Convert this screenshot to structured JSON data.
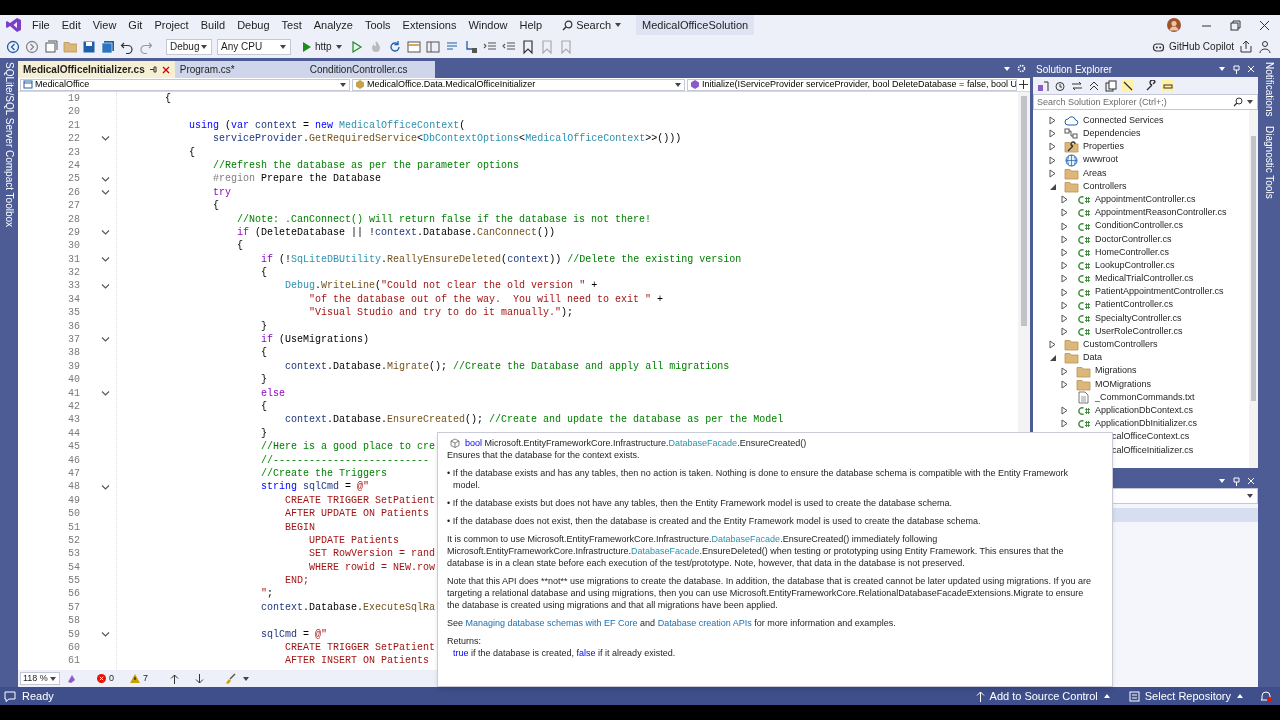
{
  "window": {
    "title": "MedicalOfficeSolution",
    "search_label": "Search"
  },
  "menu": [
    "File",
    "Edit",
    "View",
    "Git",
    "Project",
    "Build",
    "Debug",
    "Test",
    "Analyze",
    "Tools",
    "Extensions",
    "Window",
    "Help"
  ],
  "toolbar": {
    "configuration": "Debug",
    "platform": "Any CPU",
    "run_target": "http",
    "copilot": "GitHub Copilot"
  },
  "side_panels": {
    "left": "SQLite/SQL Server Compact Toolbox",
    "right": [
      "Notifications",
      "Diagnostic Tools"
    ]
  },
  "editor": {
    "tabs": [
      {
        "label": "MedicalOfficeInitializer.cs",
        "selected": true
      },
      {
        "label": "Program.cs*",
        "selected": false
      },
      {
        "label": "ConditionController.cs",
        "selected": false
      }
    ],
    "navigation": [
      "MedicalOffice",
      "MedicalOffice.Data.MedicalOfficeInitializer",
      "Initialize(IServiceProvider serviceProvider, bool DeleteDatabase = false, bool U"
    ],
    "lines": [
      {
        "number": "19",
        "code": [
          "        {"
        ]
      },
      {
        "number": "20"
      },
      {
        "number": "21",
        "code": [
          {
            "text": "            using",
            "kind": "kw"
          },
          " (",
          {
            "text": "var",
            "kind": "kw"
          },
          {
            "text": " context",
            "kind": "var"
          },
          " = ",
          {
            "text": "new",
            "kind": "kw"
          },
          {
            "text": " MedicalOfficeContext",
            "kind": "type"
          },
          "("
        ]
      },
      {
        "number": "22",
        "fold": true,
        "code": [
          {
            "text": "                serviceProvider",
            "kind": "var"
          },
          ".",
          {
            "text": "GetRequiredService",
            "kind": "method"
          },
          "<",
          {
            "text": "DbContextOptions",
            "kind": "type"
          },
          "<",
          {
            "text": "MedicalOfficeContext",
            "kind": "type"
          },
          ">>()))"
        ]
      },
      {
        "number": "23",
        "code": [
          "            {"
        ]
      },
      {
        "number": "24",
        "code": [
          {
            "text": "                //Refresh the database as per the parameter options",
            "kind": "comment"
          }
        ]
      },
      {
        "number": "25",
        "fold": true,
        "code": [
          {
            "text": "                #region",
            "kind": "preproc"
          },
          " Prepare the Database"
        ]
      },
      {
        "number": "26",
        "fold": true,
        "code": [
          {
            "text": "                try",
            "kind": "ctl"
          }
        ]
      },
      {
        "number": "27",
        "code": [
          "                {"
        ]
      },
      {
        "number": "28",
        "code": [
          {
            "text": "                    //Note: .CanConnect() will return false if the database is not there!",
            "kind": "comment"
          }
        ]
      },
      {
        "number": "29",
        "fold": true,
        "code": [
          {
            "text": "                    if",
            "kind": "ctl"
          },
          " (DeleteDatabase || !",
          {
            "text": "context",
            "kind": "var"
          },
          ".Database.",
          {
            "text": "CanConnect",
            "kind": "method"
          },
          "())"
        ]
      },
      {
        "number": "30",
        "code": [
          "                    {"
        ]
      },
      {
        "number": "31",
        "fold": true,
        "code": [
          {
            "text": "                        if",
            "kind": "ctl"
          },
          " (!",
          {
            "text": "SqLiteDBUtility",
            "kind": "type"
          },
          ".",
          {
            "text": "ReallyEnsureDeleted",
            "kind": "method"
          },
          "(",
          {
            "text": "context",
            "kind": "var"
          },
          ")) ",
          {
            "text": "//Delete the existing version",
            "kind": "comment"
          }
        ]
      },
      {
        "number": "32",
        "code": [
          "                        {"
        ]
      },
      {
        "number": "33",
        "fold": true,
        "code": [
          {
            "text": "                            Debug",
            "kind": "type"
          },
          ".",
          {
            "text": "WriteLine",
            "kind": "method"
          },
          "(",
          {
            "text": "\"Could not clear the old version \"",
            "kind": "string"
          },
          " +"
        ]
      },
      {
        "number": "34",
        "code": [
          {
            "text": "                                \"of the database out of the way.  You will need to exit \"",
            "kind": "string"
          },
          " +"
        ]
      },
      {
        "number": "35",
        "code": [
          {
            "text": "                                \"Visual Studio and try to do it manually.\"",
            "kind": "string"
          },
          ");"
        ]
      },
      {
        "number": "36",
        "code": [
          "                        }"
        ]
      },
      {
        "number": "37",
        "fold": true,
        "code": [
          {
            "text": "                        if",
            "kind": "ctl"
          },
          " (UseMigrations)"
        ]
      },
      {
        "number": "38",
        "code": [
          "                        {"
        ]
      },
      {
        "number": "39",
        "code": [
          {
            "text": "                            context",
            "kind": "var"
          },
          ".Database.",
          {
            "text": "Migrate",
            "kind": "method"
          },
          "(); ",
          {
            "text": "//Create the Database and apply all migrations",
            "kind": "comment"
          }
        ]
      },
      {
        "number": "40",
        "code": [
          "                        }"
        ]
      },
      {
        "number": "41",
        "fold": true,
        "code": [
          {
            "text": "                        else",
            "kind": "ctl"
          }
        ]
      },
      {
        "number": "42",
        "code": [
          "                        {"
        ]
      },
      {
        "number": "43",
        "code": [
          {
            "text": "                            context",
            "kind": "var"
          },
          ".Database.",
          {
            "text": "EnsureCreated",
            "kind": "method"
          },
          "(); ",
          {
            "text": "//Create and update the database as per the Model",
            "kind": "comment"
          }
        ]
      },
      {
        "number": "44",
        "code": [
          "                        }"
        ]
      },
      {
        "number": "45",
        "code": [
          {
            "text": "                        //Here is a good place to cre",
            "kind": "comment"
          }
        ]
      },
      {
        "number": "46",
        "code": [
          {
            "text": "                        //--------------------------",
            "kind": "comment"
          }
        ]
      },
      {
        "number": "47",
        "code": [
          {
            "text": "                        //Create the Triggers",
            "kind": "comment"
          }
        ]
      },
      {
        "number": "48",
        "fold": true,
        "code": [
          {
            "text": "                        string",
            "kind": "kw"
          },
          {
            "text": " sqlCmd",
            "kind": "var"
          },
          " = ",
          {
            "text": "@\"",
            "kind": "string"
          }
        ]
      },
      {
        "number": "49",
        "code": [
          {
            "text": "                            CREATE TRIGGER SetPatient",
            "kind": "string"
          }
        ]
      },
      {
        "number": "50",
        "code": [
          {
            "text": "                            AFTER UPDATE ON Patients",
            "kind": "string"
          }
        ]
      },
      {
        "number": "51",
        "code": [
          {
            "text": "                            BEGIN",
            "kind": "string"
          }
        ]
      },
      {
        "number": "52",
        "code": [
          {
            "text": "                                UPDATE Patients",
            "kind": "string"
          }
        ]
      },
      {
        "number": "53",
        "code": [
          {
            "text": "                                SET RowVersion = rand",
            "kind": "string"
          }
        ]
      },
      {
        "number": "54",
        "code": [
          {
            "text": "                                WHERE rowid = NEW.row",
            "kind": "string"
          }
        ]
      },
      {
        "number": "55",
        "code": [
          {
            "text": "                            END;",
            "kind": "string"
          }
        ]
      },
      {
        "number": "56",
        "code": [
          {
            "text": "                        \"",
            "kind": "string"
          },
          ";"
        ]
      },
      {
        "number": "57",
        "code": [
          {
            "text": "                        context",
            "kind": "var"
          },
          ".Database.",
          {
            "text": "ExecuteSqlRa",
            "kind": "method"
          }
        ]
      },
      {
        "number": "58"
      },
      {
        "number": "59",
        "fold": true,
        "code": [
          {
            "text": "                        sqlCmd",
            "kind": "var"
          },
          " = ",
          {
            "text": "@\"",
            "kind": "string"
          }
        ]
      },
      {
        "number": "60",
        "code": [
          {
            "text": "                            CREATE TRIGGER SetPatient",
            "kind": "string"
          }
        ]
      },
      {
        "number": "61",
        "code": [
          {
            "text": "                            AFTER INSERT ON Patients",
            "kind": "string"
          }
        ]
      }
    ],
    "zoom": "118 %",
    "errors": "0",
    "warnings": "7"
  },
  "tooltip": {
    "signature": [
      {
        "text": "bool",
        "kind": "keyword"
      },
      " Microsoft.EntityFrameworkCore.Infrastructure.",
      {
        "text": "DatabaseFacade",
        "kind": "type"
      },
      ".EnsureCreated()"
    ],
    "summary": "Ensures that the database for the context exists.",
    "paragraphs": [
      {
        "kind": "bullet",
        "segments": [
          "• If the database exists and has any tables, then no action is taken. Nothing is done to ensure the database schema is compatible with the Entity Framework model."
        ]
      },
      {
        "kind": "bullet",
        "segments": [
          "• If the database exists but does not have any tables, then the Entity Framework model is used to create the database schema."
        ]
      },
      {
        "kind": "bullet",
        "segments": [
          "• If the database does not exist, then the database is created and the Entity Framework model is used to create the database schema."
        ]
      },
      {
        "kind": "text",
        "segments": [
          "It is common to use Microsoft.EntityFrameworkCore.Infrastructure.",
          {
            "text": "DatabaseFacade",
            "kind": "type"
          },
          ".EnsureCreated() immediately following Microsoft.EntityFrameworkCore.Infrastructure.",
          {
            "text": "DatabaseFacade",
            "kind": "type"
          },
          ".EnsureDeleted() when testing or prototyping using Entity Framework. This ensures that the database is in a clean state before each execution of the test/prototype. Note, however, that data in the database is not preserved."
        ]
      },
      {
        "kind": "text",
        "segments": [
          "Note that this API does **not** use migrations to create the database. In addition, the database that is created cannot be later updated using migrations. If you are targeting a relational database and using migrations, then you can use Microsoft.EntityFrameworkCore.RelationalDatabaseFacadeExtensions.Migrate to ensure the database is created using migrations and that all migrations have been applied."
        ]
      },
      {
        "kind": "text",
        "segments": [
          "See ",
          {
            "text": "Managing database schemas with EF Core",
            "kind": "link"
          },
          " and ",
          {
            "text": "Database creation APIs",
            "kind": "link"
          },
          " for more information and examples."
        ]
      }
    ],
    "returns_label": "Returns:",
    "returns": [
      {
        "text": "true",
        "kind": "keyword"
      },
      " if the database is created, ",
      {
        "text": "false",
        "kind": "keyword"
      },
      " if it already existed."
    ]
  },
  "solution_explorer": {
    "title": "Solution Explorer",
    "search": {
      "placeholder": "Search Solution Explorer (Ctrl+;)"
    },
    "items": [
      {
        "label": "Connected Services",
        "kind": "cloud",
        "expanded": false
      },
      {
        "label": "Dependencies",
        "kind": "dependencies",
        "expanded": false
      },
      {
        "label": "Properties",
        "kind": "properties",
        "expanded": false
      },
      {
        "label": "wwwroot",
        "kind": "globe",
        "expanded": false
      },
      {
        "label": "Areas",
        "kind": "folder",
        "expanded": false
      },
      {
        "label": "Controllers",
        "kind": "folder",
        "expanded": true,
        "children": [
          {
            "label": "AppointmentController.cs",
            "kind": "csharp",
            "expanded": false
          },
          {
            "label": "AppointmentReasonController.cs",
            "kind": "csharp",
            "expanded": false
          },
          {
            "label": "ConditionController.cs",
            "kind": "csharp",
            "expanded": false
          },
          {
            "label": "DoctorController.cs",
            "kind": "csharp",
            "expanded": false
          },
          {
            "label": "HomeController.cs",
            "kind": "csharp",
            "expanded": false
          },
          {
            "label": "LookupController.cs",
            "kind": "csharp",
            "expanded": false
          },
          {
            "label": "MedicalTrialController.cs",
            "kind": "csharp",
            "expanded": false
          },
          {
            "label": "PatientAppointmentController.cs",
            "kind": "csharp",
            "expanded": false
          },
          {
            "label": "PatientController.cs",
            "kind": "csharp",
            "expanded": false
          },
          {
            "label": "SpecialtyController.cs",
            "kind": "csharp",
            "expanded": false
          },
          {
            "label": "UserRoleController.cs",
            "kind": "csharp",
            "expanded": false
          }
        ]
      },
      {
        "label": "CustomControllers",
        "kind": "folder",
        "expanded": false
      },
      {
        "label": "Data",
        "kind": "folder",
        "expanded": true,
        "children": [
          {
            "label": "Migrations",
            "kind": "folder",
            "expanded": false
          },
          {
            "label": "MOMigrations",
            "kind": "folder",
            "expanded": false
          },
          {
            "label": "_CommonCommands.txt",
            "kind": "text"
          },
          {
            "label": "ApplicationDbContext.cs",
            "kind": "csharp",
            "expanded": false
          },
          {
            "label": "ApplicationDbInitializer.cs",
            "kind": "csharp",
            "expanded": false
          },
          {
            "label": "calOfficeContext.cs"
          },
          {
            "label": "calOfficeInitializer.cs"
          }
        ]
      }
    ]
  },
  "status_bar": {
    "text": "Ready",
    "source_control": "Add to Source Control",
    "repository": "Select Repository"
  }
}
